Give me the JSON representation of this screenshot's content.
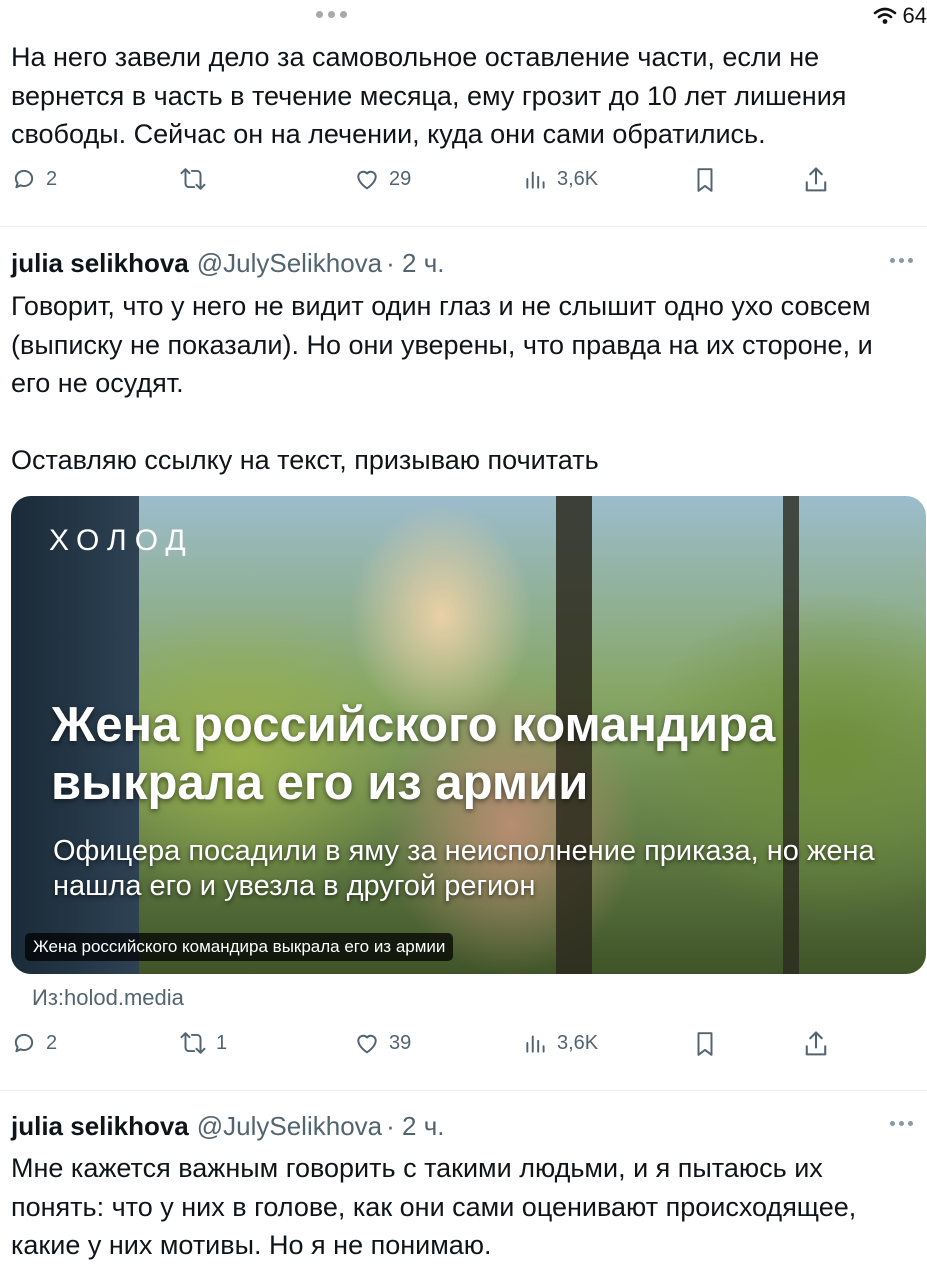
{
  "status_bar": {
    "battery": "64"
  },
  "tweets": [
    {
      "text": "На него завели дело за самовольное оставление части, если не вернется в часть в течение месяца, ему грозит до 10 лет лишения свободы. Сейчас он на лечении, куда они сами обратились.",
      "stats": {
        "replies": "2",
        "reposts": "",
        "likes": "29",
        "views": "3,6K"
      }
    },
    {
      "author": {
        "name": "julia selikhova",
        "handle": "@JulySelikhova",
        "time": "· 2 ч."
      },
      "paragraphs": [
        "Говорит, что у него не видит один глаз и не слышит одно ухо совсем (выписку не показали). Но они уверены, что правда на их стороне, и его не осудят.",
        "Оставляю ссылку на текст, призываю почитать"
      ],
      "card": {
        "logo": "ХОЛОД",
        "headline": "Жена российского командира выкрала его из армии",
        "subheadline": "Офицера посадили в яму за неисполнение приказа, но жена нашла его и увезла в другой регион",
        "caption": "Жена российского командира выкрала его из армии",
        "source": "Из:holod.media"
      },
      "stats": {
        "replies": "2",
        "reposts": "1",
        "likes": "39",
        "views": "3,6K"
      }
    },
    {
      "author": {
        "name": "julia selikhova",
        "handle": "@JulySelikhova",
        "time": "· 2 ч."
      },
      "text": "Мне кажется важным говорить с такими людьми, и я пытаюсь их понять: что у них в голове, как они сами оценивают происходящее, какие у них мотивы. Но я не понимаю."
    }
  ],
  "icons": {
    "reply": "reply-icon",
    "repost": "repost-icon",
    "like": "like-icon",
    "views": "views-icon",
    "bookmark": "bookmark-icon",
    "share": "share-icon",
    "more": "more-icon",
    "wifi": "wifi-icon"
  },
  "colors": {
    "text": "#0f1419",
    "secondary": "#536471",
    "divider": "#eff3f4"
  }
}
